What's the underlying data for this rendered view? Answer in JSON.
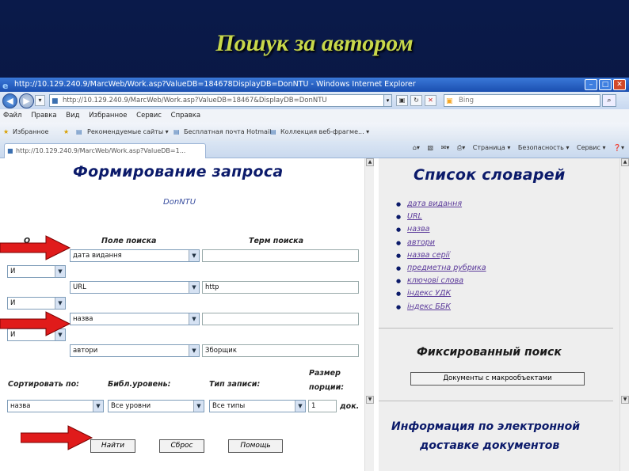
{
  "slide": {
    "title": "Пошук за автором"
  },
  "window": {
    "title": "http://10.129.240.9/MarcWeb/Work.asp?ValueDB=184678DisplayDB=DonNTU - Windows Internet Explorer",
    "url": "http://10.129.240.9/MarcWeb/Work.asp?ValueDB=18467&DisplayDB=DonNTU",
    "search_placeholder": "Bing",
    "menu": [
      "Файл",
      "Правка",
      "Вид",
      "Избранное",
      "Сервис",
      "Справка"
    ],
    "favorites": [
      "Избранное",
      "Рекомендуемые сайты ▾",
      "Бесплатная почта Hotmail",
      "Коллекция веб-фрагме... ▾"
    ],
    "tab_title": "http://10.129.240.9/MarcWeb/Work.asp?ValueDB=1...",
    "commands": [
      "Страница ▾",
      "Безопасность ▾",
      "Сервис ▾",
      "❓▾"
    ]
  },
  "query_form": {
    "title": "Формирование запроса",
    "db_name": "DonNTU",
    "col_field": "Поле поиска",
    "col_term": "Терм поиска",
    "rows": [
      {
        "field": "дата видання",
        "term": ""
      },
      {
        "op": "И",
        "field": "URL",
        "term": "http"
      },
      {
        "op": "И",
        "field": "назва",
        "term": ""
      },
      {
        "op": "И",
        "field": "автори",
        "term": "Зборщик"
      }
    ],
    "first_op": "И",
    "sort_label": "Сортировать по:",
    "level_label": "Библ.уровень:",
    "type_label": "Тип записи:",
    "size_label_1": "Размер",
    "size_label_2": "порции:",
    "sort_value": "назва",
    "level_value": "Все уровни",
    "type_value": "Все типы",
    "size_value": "1",
    "size_unit": "док.",
    "find_button": "Найти",
    "reset_button": "Сброс",
    "help_button": "Помощь"
  },
  "dictionaries": {
    "title": "Список словарей",
    "items": [
      "дата видання",
      "URL",
      "назва",
      "автори",
      "назва серії",
      "предметна рубрика",
      "ключові слова",
      "індекс УДК",
      "індекс ББК"
    ],
    "fixed_title": "Фиксированный поиск",
    "fixed_button": "Документы с макрообъектами",
    "info_title_1": "Информация по электронной",
    "info_title_2": "доставке документов"
  }
}
